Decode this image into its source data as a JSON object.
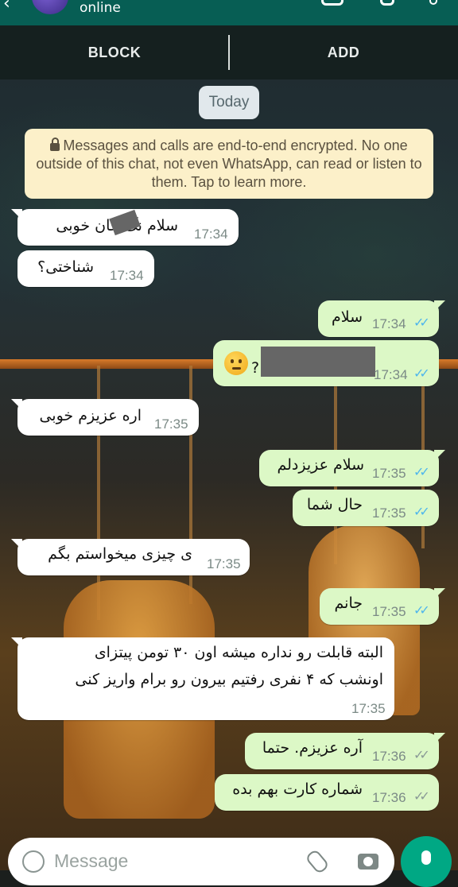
{
  "header": {
    "status": "online"
  },
  "actions": {
    "block": "BLOCK",
    "add": "ADD"
  },
  "date_chip": "Today",
  "encryption_notice": "Messages and calls are end-to-end encrypted. No one outside of this chat, not even WhatsApp, can read or listen to them. Tap to learn more.",
  "messages": [
    {
      "dir": "in",
      "text": "سلام نگ جان خوبی",
      "time": "17:34"
    },
    {
      "dir": "in",
      "text": "شناختی؟",
      "time": "17:34"
    },
    {
      "dir": "out",
      "text": "سلام",
      "time": "17:34",
      "ticks": "read"
    },
    {
      "dir": "out",
      "text": "?",
      "time": "17:34",
      "ticks": "read",
      "emoji": "thinking-face"
    },
    {
      "dir": "in",
      "text": "اره عزیزم خوبی",
      "time": "17:35"
    },
    {
      "dir": "out",
      "text": "سلام عزیزدلم",
      "time": "17:35",
      "ticks": "read"
    },
    {
      "dir": "out",
      "text": "حال شما",
      "time": "17:35",
      "ticks": "read"
    },
    {
      "dir": "in",
      "text": "ی چیزی میخواستم بگم",
      "time": "17:35"
    },
    {
      "dir": "out",
      "text": "جانم",
      "time": "17:35",
      "ticks": "read"
    },
    {
      "dir": "in",
      "lines": [
        "البته قابلت رو نداره میشه اون ۳۰ تومن پیتزای",
        "اونشب که ۴ نفری رفتیم بیرون رو برام واریز کنی"
      ],
      "time": "17:35"
    },
    {
      "dir": "out",
      "text": "آره عزیزم. حتما",
      "time": "17:36",
      "ticks": "delivered"
    },
    {
      "dir": "out",
      "text": "شماره کارت بهم بده",
      "time": "17:36",
      "ticks": "delivered"
    }
  ],
  "composer": {
    "placeholder": "Message"
  },
  "colors": {
    "header": "#075e54",
    "outgoing_bubble": "#dcf8c6",
    "incoming_bubble": "#ffffff",
    "read_ticks": "#4fb6ec",
    "mic_button": "#00a884"
  }
}
